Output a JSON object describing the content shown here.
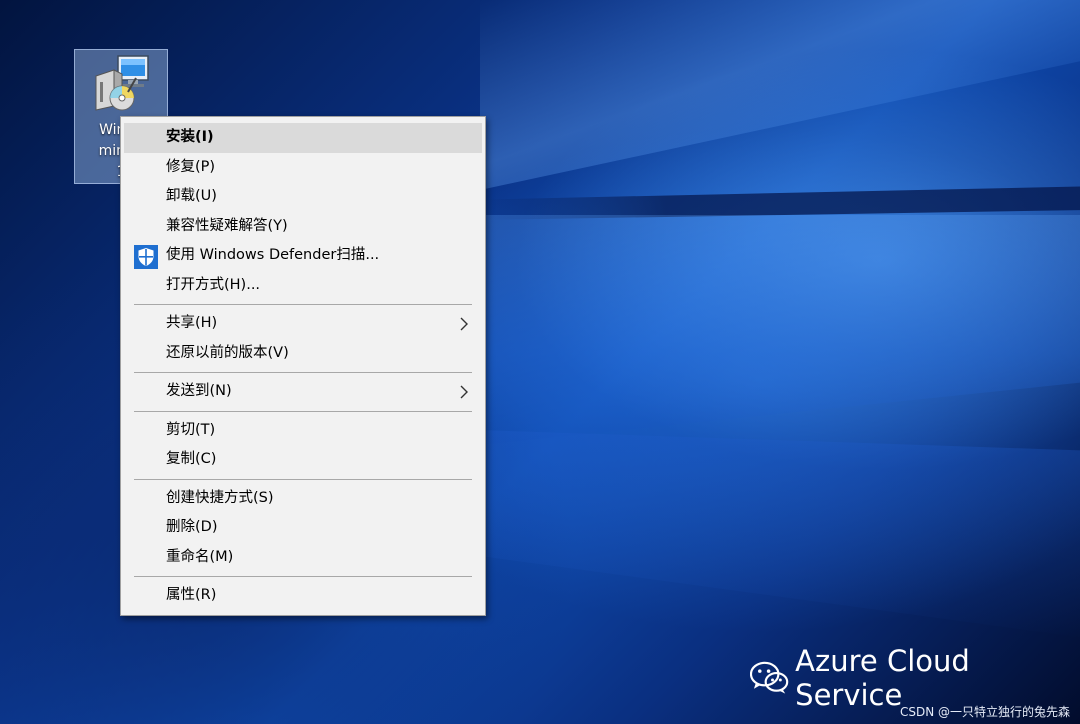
{
  "desktop_icon": {
    "name": "setup-package",
    "label_lines": [
      "Windo",
      "minCe",
      "1"
    ]
  },
  "context_menu": {
    "groups": [
      [
        {
          "label": "安装(I)",
          "default": true,
          "hover": true
        },
        {
          "label": "修复(P)"
        },
        {
          "label": "卸载(U)"
        },
        {
          "label": "兼容性疑难解答(Y)"
        },
        {
          "label": "使用 Windows Defender扫描...",
          "icon": "windows-defender-shield-icon"
        },
        {
          "label": "打开方式(H)..."
        }
      ],
      [
        {
          "label": "共享(H)",
          "submenu": true
        },
        {
          "label": "还原以前的版本(V)"
        }
      ],
      [
        {
          "label": "发送到(N)",
          "submenu": true
        }
      ],
      [
        {
          "label": "剪切(T)"
        },
        {
          "label": "复制(C)"
        }
      ],
      [
        {
          "label": "创建快捷方式(S)"
        },
        {
          "label": "删除(D)"
        },
        {
          "label": "重命名(M)"
        }
      ],
      [
        {
          "label": "属性(R)"
        }
      ]
    ]
  },
  "watermark": {
    "brand": "Azure Cloud Service",
    "author": "CSDN @一只特立独行的兔先森"
  },
  "colors": {
    "menu_bg": "#f2f2f2",
    "menu_hover": "#dadada",
    "defender_blue": "#1f6fd0"
  }
}
